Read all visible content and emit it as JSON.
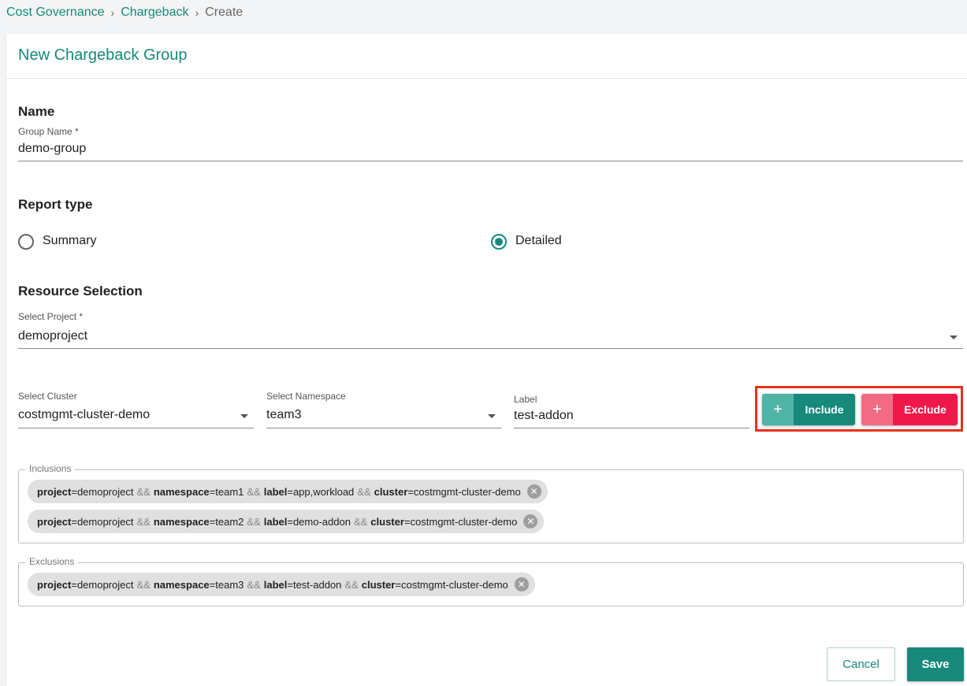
{
  "breadcrumb": {
    "items": [
      "Cost Governance",
      "Chargeback"
    ],
    "current": "Create",
    "separator": "›"
  },
  "card": {
    "title": "New Chargeback Group"
  },
  "name_section": {
    "title": "Name",
    "group_name_label": "Group Name *",
    "group_name_value": "demo-group"
  },
  "report_type": {
    "title": "Report type",
    "options": [
      {
        "label": "Summary",
        "selected": false
      },
      {
        "label": "Detailed",
        "selected": true
      }
    ]
  },
  "resource_selection": {
    "title": "Resource Selection",
    "project_label": "Select Project *",
    "project_value": "demoproject",
    "cluster_label": "Select Cluster",
    "cluster_value": "costmgmt-cluster-demo",
    "namespace_label": "Select Namespace",
    "namespace_value": "team3",
    "label_label": "Label",
    "label_value": "test-addon",
    "include_button": "Include",
    "exclude_button": "Exclude",
    "plus_glyph": "+"
  },
  "inclusions": {
    "legend": "Inclusions",
    "chips": [
      {
        "project": "demoproject",
        "namespace": "team1",
        "label": "app,workload",
        "cluster": "costmgmt-cluster-demo"
      },
      {
        "project": "demoproject",
        "namespace": "team2",
        "label": "demo-addon",
        "cluster": "costmgmt-cluster-demo"
      }
    ]
  },
  "exclusions": {
    "legend": "Exclusions",
    "chips": [
      {
        "project": "demoproject",
        "namespace": "team3",
        "label": "test-addon",
        "cluster": "costmgmt-cluster-demo"
      }
    ]
  },
  "chip_keys": {
    "project": "project",
    "namespace": "namespace",
    "label": "label",
    "cluster": "cluster",
    "op": "&&",
    "eq": "="
  },
  "actions": {
    "cancel": "Cancel",
    "save": "Save"
  },
  "colors": {
    "accent": "#16897b",
    "exclude": "#f0184a",
    "highlight": "#e6331b"
  }
}
